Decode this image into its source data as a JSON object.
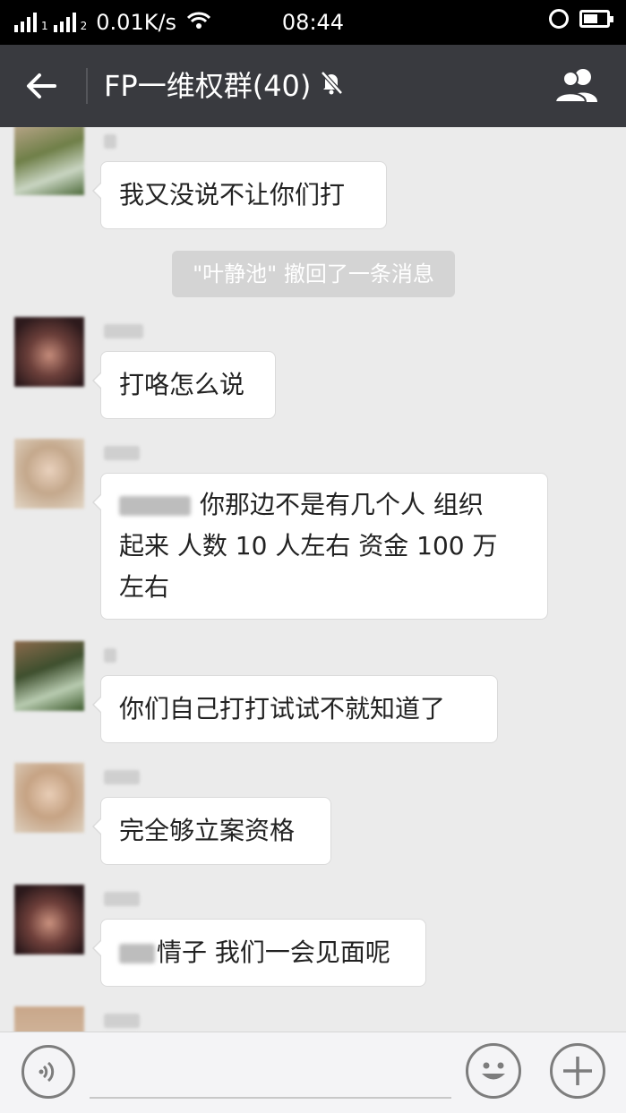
{
  "status_bar": {
    "sim1": "1",
    "sim2": "2",
    "network_speed": "0.01K/s",
    "time": "08:44",
    "icons": [
      "signal-icon",
      "wifi-icon",
      "alarm-icon",
      "battery-icon"
    ]
  },
  "header": {
    "title": "FP一维权群(40)",
    "muted_icon": "bell-muted-icon",
    "back_icon": "back-arrow-icon",
    "members_icon": "group-members-icon"
  },
  "messages": [
    {
      "text": "我又没说不让你们打"
    },
    {
      "system": "\"叶静池\" 撤回了一条消息"
    },
    {
      "text": "打咯怎么说"
    },
    {
      "line1_visible": "你那边不是有几个人 组织",
      "line2": "起来  人数 10 人左右  资金 100 万",
      "line3": "左右"
    },
    {
      "text": "你们自己打打试试不就知道了"
    },
    {
      "text": "完全够立案资格"
    },
    {
      "text_visible": "情子  我们一会见面呢"
    }
  ],
  "input_bar": {
    "voice_icon": "voice-icon",
    "emoji_icon": "emoji-icon",
    "plus_icon": "plus-icon"
  },
  "colors": {
    "header_bg": "#393a3f",
    "chat_bg": "#ebebeb",
    "bubble_bg": "#ffffff"
  }
}
